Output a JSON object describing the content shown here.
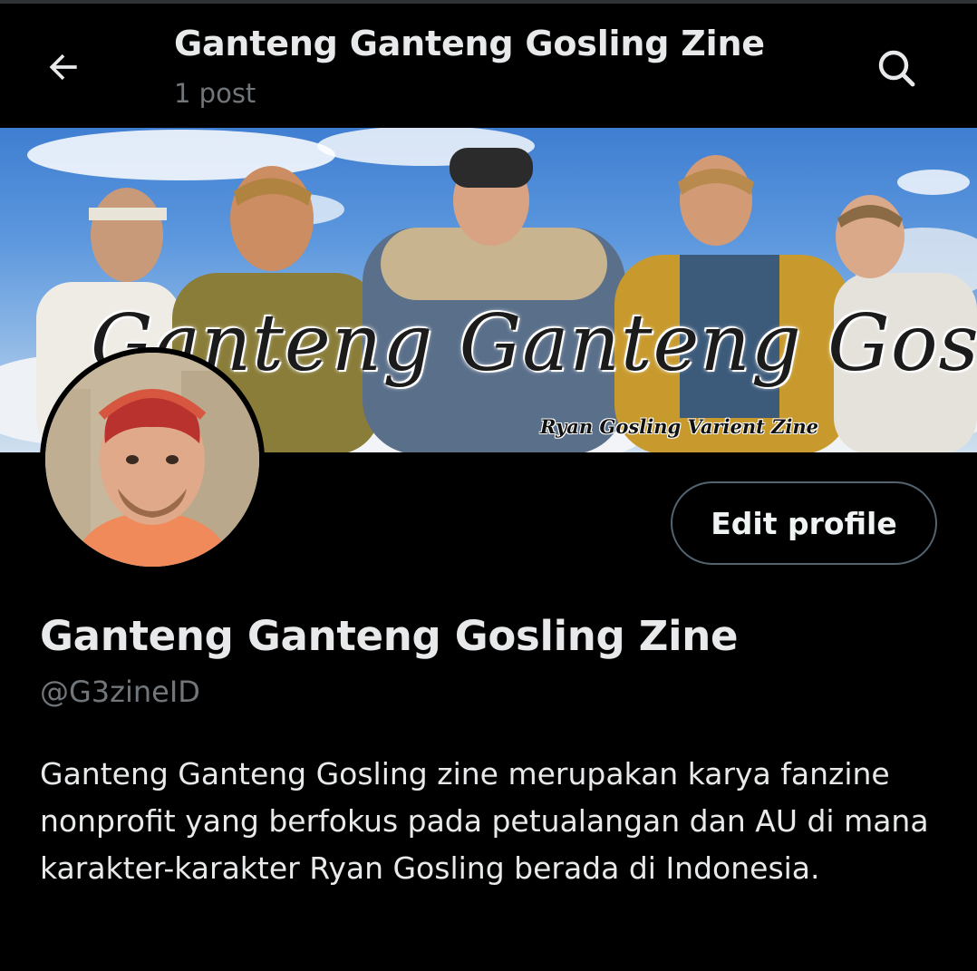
{
  "header": {
    "back_icon": "arrow-left-icon",
    "title": "Ganteng Ganteng Gosling Zine",
    "post_count": "1 post",
    "search_icon": "search-icon"
  },
  "banner": {
    "title_text": "Ganteng Ganteng Gosling",
    "subtitle_text": "Ryan Gosling Varient Zine"
  },
  "profile": {
    "edit_button_label": "Edit profile",
    "display_name": "Ganteng Ganteng Gosling Zine",
    "handle": "@G3zineID",
    "bio": "Ganteng Ganteng Gosling zine merupakan karya fanzine nonprofit yang berfokus pada petualangan dan AU di mana karakter-karakter Ryan Gosling berada di Indonesia."
  },
  "colors": {
    "background": "#000000",
    "text_primary": "#e7e9ea",
    "text_secondary": "#71767b",
    "button_border": "#536471"
  }
}
